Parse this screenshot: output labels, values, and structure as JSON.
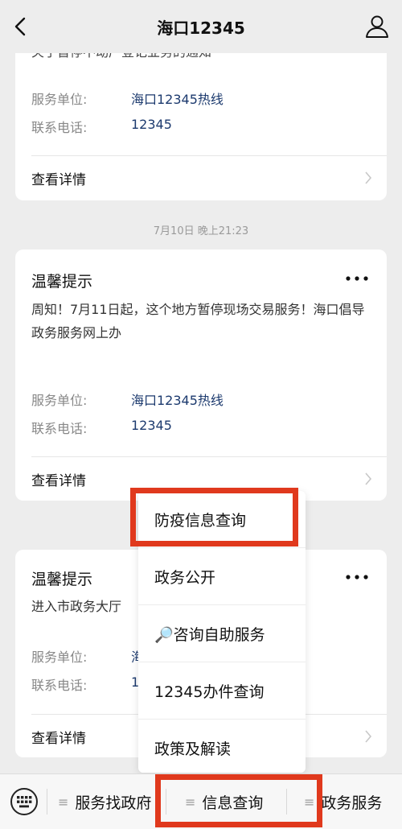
{
  "header": {
    "title": "海口12345"
  },
  "cards": [
    {
      "body_partial": "关于暂停不动产登记业务的通知",
      "unit_label": "服务单位:",
      "unit_value": "海口12345热线",
      "phone_label": "联系电话:",
      "phone_value": "12345",
      "detail_label": "查看详情"
    },
    {
      "title": "温馨提示",
      "body": "周知！7月11日起，这个地方暂停现场交易服务！海口倡导政务服务网上办",
      "unit_label": "服务单位:",
      "unit_value": "海口12345热线",
      "phone_label": "联系电话:",
      "phone_value": "12345",
      "detail_label": "查看详情"
    },
    {
      "title": "温馨提示",
      "body": "进入市政务大厅",
      "unit_label": "服务单位:",
      "unit_value": "海",
      "phone_label": "联系电话:",
      "phone_value": "1",
      "detail_label": "查看详情"
    }
  ],
  "timestamp": "7月10日 晚上21:23",
  "popup_menu": {
    "items": [
      "防疫信息查询",
      "政务公开",
      "🔎咨询自助服务",
      "12345办件查询",
      "政策及解读"
    ]
  },
  "bottom_menu": {
    "tabs": [
      "服务找政府",
      "信息查询",
      "政务服务"
    ]
  },
  "colors": {
    "highlight": "#e0391d",
    "link_value": "#1c3a6e",
    "background": "#ededed"
  }
}
